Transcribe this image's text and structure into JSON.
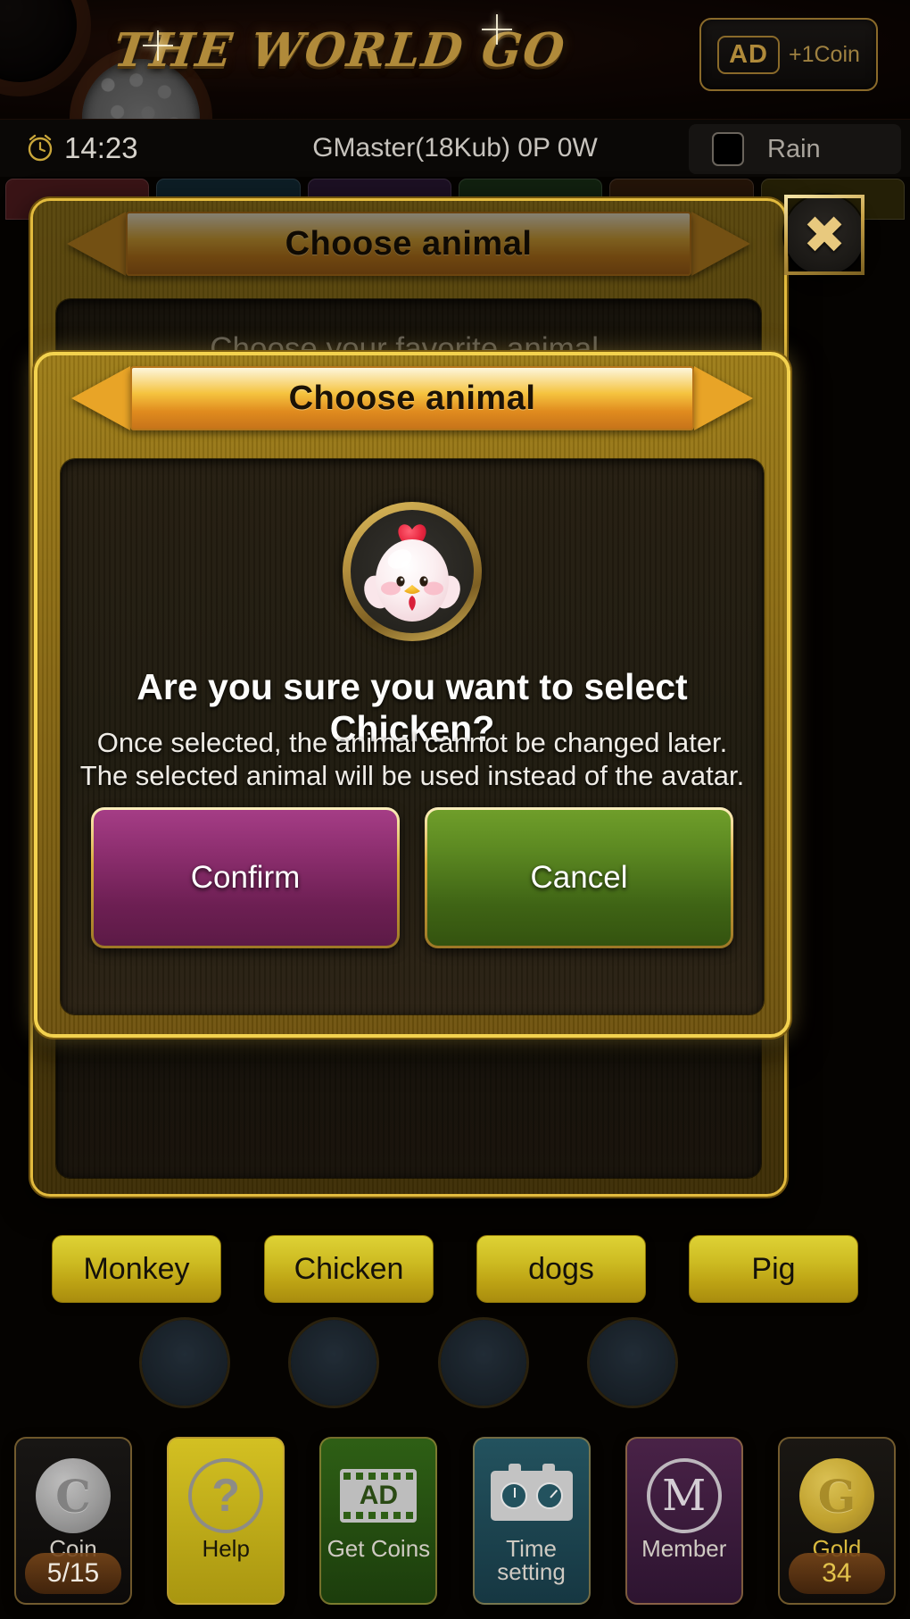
{
  "header": {
    "logo_text": "THE WORLD GO",
    "ad_badge": "AD",
    "ad_reward": "+1Coin"
  },
  "statusbar": {
    "clock_icon": "alarm-clock-icon",
    "time": "14:23",
    "player_info": "GMaster(18Kub) 0P 0W",
    "rain_label": "Rain",
    "rain_checked": false
  },
  "tabs": [
    {
      "name": "tab-1",
      "color": "#3a1416"
    },
    {
      "name": "tab-2",
      "color": "#0d1e26"
    },
    {
      "name": "tab-3",
      "color": "#1d1024"
    },
    {
      "name": "tab-4",
      "color": "#11210f"
    },
    {
      "name": "tab-5",
      "color": "#241408"
    },
    {
      "name": "tab-6",
      "color": "#241f06"
    }
  ],
  "back_dialog": {
    "title": "Choose animal",
    "subtitle": "Choose your favorite animal.",
    "close_icon": "close-icon",
    "left_arrow_icon": "arrow-left-icon",
    "right_arrow_icon": "arrow-right-icon"
  },
  "front_dialog": {
    "title": "Choose animal",
    "left_arrow_icon": "arrow-left-icon",
    "right_arrow_icon": "arrow-right-icon",
    "avatar_icon": "chicken-avatar-icon",
    "question": "Are you sure you want to select Chicken?",
    "note_line_1": "Once selected, the animal cannot be changed later.",
    "note_line_2": "The selected animal will be used instead of the avatar.",
    "confirm_label": "Confirm",
    "cancel_label": "Cancel",
    "confirm_color": "#8e2f70",
    "cancel_color": "#5d8a22"
  },
  "animal_tags": [
    {
      "label": "Monkey"
    },
    {
      "label": "Chicken"
    },
    {
      "label": "dogs"
    },
    {
      "label": "Pig"
    }
  ],
  "toolbar": [
    {
      "name": "coin",
      "icon": "coin-icon",
      "label": "Coin",
      "count": "5/15"
    },
    {
      "name": "help",
      "icon": "question-icon",
      "label": "Help",
      "count": null
    },
    {
      "name": "get-coins",
      "icon": "ad-video-icon",
      "label": "Get Coins",
      "count": null
    },
    {
      "name": "time-setting",
      "icon": "game-clock-icon",
      "label": "Time setting",
      "count": null
    },
    {
      "name": "member",
      "icon": "member-icon",
      "label": "Member",
      "count": null
    },
    {
      "name": "gold",
      "icon": "gold-coin-icon",
      "label": "Gold",
      "count": "34"
    }
  ],
  "colors": {
    "gold_frame": "#e3bb3e",
    "gold_frame_bright": "#f3d24f",
    "panel_dark": "#241d10",
    "tag_yellow": "#cdbb22"
  }
}
